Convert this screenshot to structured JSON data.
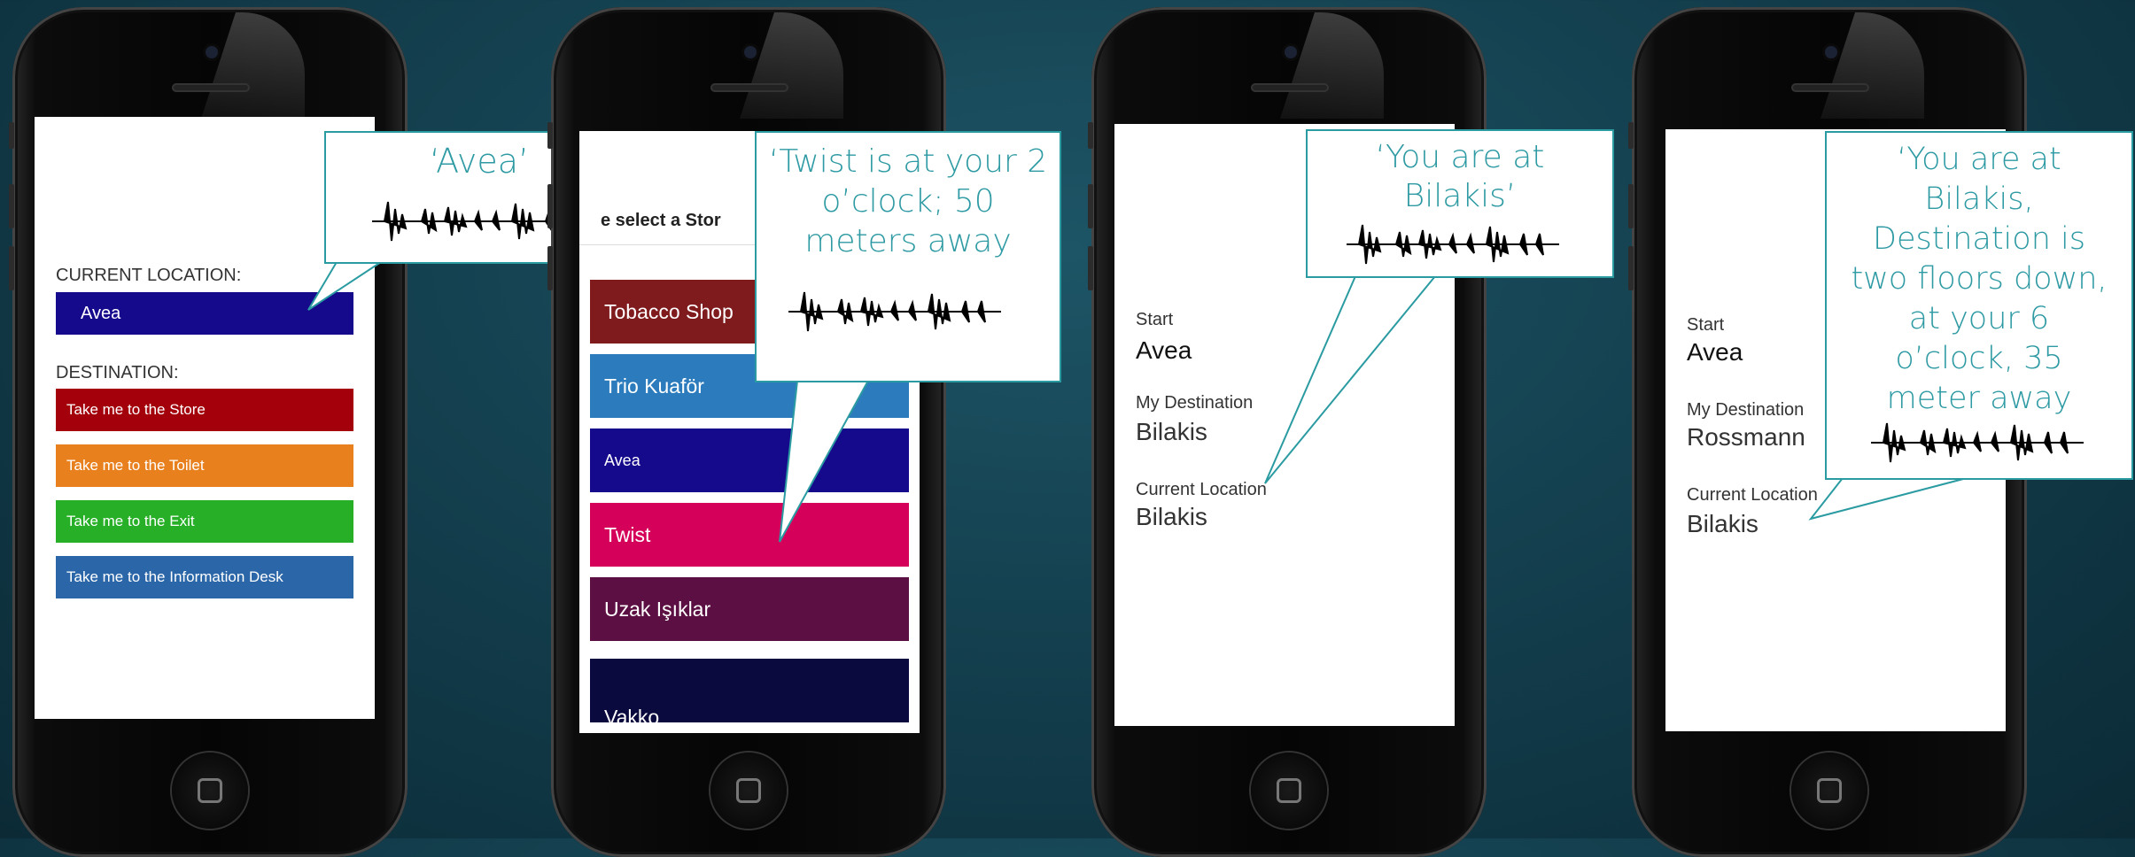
{
  "colors": {
    "teal": "#2e9aa3",
    "avea": "#160a8c",
    "store": "#a3000b",
    "toilet": "#e8801e",
    "exit": "#27b027",
    "info": "#2b67a8",
    "tobacco": "#7f1a1d",
    "trio": "#2b7bbd",
    "twist": "#d5005a",
    "uzak": "#5c0f42",
    "vakko": "#0a0a3e"
  },
  "screen1": {
    "current_location_label": "CURRENT LOCATION:",
    "current_location_value": "Avea",
    "destination_label": "DESTINATION:",
    "buttons": [
      "Take me to the Store",
      "Take me to the Toilet",
      "Take me to the Exit",
      "Take me to the Information Desk"
    ],
    "speech": "‘Avea’"
  },
  "screen2": {
    "picker_prompt": "e select a Stor",
    "stores": [
      "Tobacco Shop",
      "Trio Kuaför",
      "Avea",
      "Twist",
      "Uzak Işıklar",
      "Vakko"
    ],
    "speech_lines": [
      "‘Twist is at your 2",
      "o’clock; 50",
      "meters away"
    ]
  },
  "screen3": {
    "start_label": "Start",
    "start_value": "Avea",
    "destination_label": "My Destination",
    "destination_value": "Bilakis",
    "current_label": "Current Location",
    "current_value": "Bilakis",
    "speech_lines": [
      "‘You are at",
      "Bilakis’"
    ]
  },
  "screen4": {
    "start_label": "Start",
    "start_value": "Avea",
    "destination_label": "My Destination",
    "destination_value": "Rossmann",
    "current_label": "Current Location",
    "current_value": "Bilakis",
    "speech_lines": [
      "‘You are at",
      "Bilakis,",
      "Destination is",
      "two floors down,",
      "at your 6",
      "o’clock, 35",
      "meter away"
    ]
  },
  "icons": [
    "audio-waveform-icon",
    "home-button-icon",
    "camera-icon"
  ]
}
